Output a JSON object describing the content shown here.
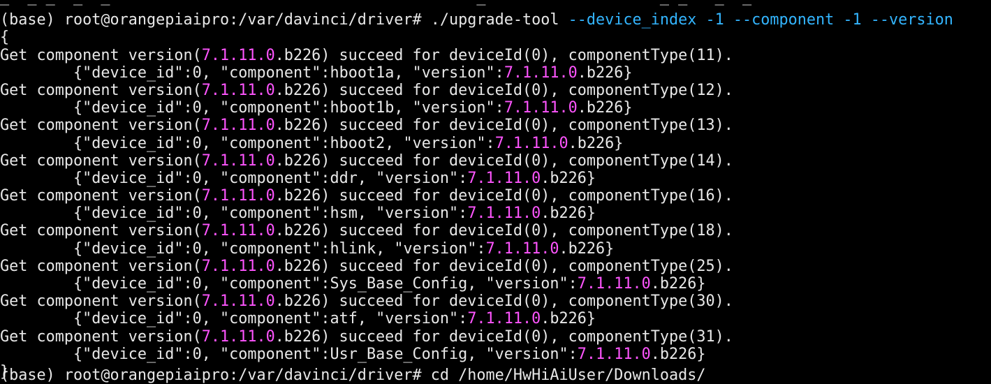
{
  "terminal": {
    "colors": {
      "background": "#000000",
      "text": "#e8e8e8",
      "number": "#ff55ff",
      "option": "#33b5ff"
    },
    "partial_top_line": "_  _ _  _  _                                        _                   _ _   _  _ ",
    "prompt": "(base) root@orangepiaipro:/var/davinci/driver# ",
    "command": "./upgrade-tool",
    "args": [
      " --device_index",
      " -1",
      " --component",
      " -1",
      " --version"
    ],
    "open_brace": "{",
    "close_brace": "}",
    "partial_bottom_line": "(base) root@orangepiaipro:/var/davinci/driver# cd /home/HwHiAiUser/Downloads/",
    "entries": [
      {
        "get_prefix": "Get component version(",
        "ver_major": "7.1.11.0",
        "ver_build": ".b226",
        "get_mid": ") succeed for deviceId(0), componentType(",
        "type": "11",
        "get_end": ").",
        "json_prefix": "{\"device_id\":0, \"component\":",
        "component": "hboot1a",
        "json_mid": ", \"version\":",
        "json_ver_major": "7.1.11.0",
        "json_ver_build": ".b226",
        "json_end": "}"
      },
      {
        "get_prefix": "Get component version(",
        "ver_major": "7.1.11.0",
        "ver_build": ".b226",
        "get_mid": ") succeed for deviceId(0), componentType(",
        "type": "12",
        "get_end": ").",
        "json_prefix": "{\"device_id\":0, \"component\":",
        "component": "hboot1b",
        "json_mid": ", \"version\":",
        "json_ver_major": "7.1.11.0",
        "json_ver_build": ".b226",
        "json_end": "}"
      },
      {
        "get_prefix": "Get component version(",
        "ver_major": "7.1.11.0",
        "ver_build": ".b226",
        "get_mid": ") succeed for deviceId(0), componentType(",
        "type": "13",
        "get_end": ").",
        "json_prefix": "{\"device_id\":0, \"component\":",
        "component": "hboot2",
        "json_mid": ", \"version\":",
        "json_ver_major": "7.1.11.0",
        "json_ver_build": ".b226",
        "json_end": "}"
      },
      {
        "get_prefix": "Get component version(",
        "ver_major": "7.1.11.0",
        "ver_build": ".b226",
        "get_mid": ") succeed for deviceId(0), componentType(",
        "type": "14",
        "get_end": ").",
        "json_prefix": "{\"device_id\":0, \"component\":",
        "component": "ddr",
        "json_mid": ", \"version\":",
        "json_ver_major": "7.1.11.0",
        "json_ver_build": ".b226",
        "json_end": "}"
      },
      {
        "get_prefix": "Get component version(",
        "ver_major": "7.1.11.0",
        "ver_build": ".b226",
        "get_mid": ") succeed for deviceId(0), componentType(",
        "type": "16",
        "get_end": ").",
        "json_prefix": "{\"device_id\":0, \"component\":",
        "component": "hsm",
        "json_mid": ", \"version\":",
        "json_ver_major": "7.1.11.0",
        "json_ver_build": ".b226",
        "json_end": "}"
      },
      {
        "get_prefix": "Get component version(",
        "ver_major": "7.1.11.0",
        "ver_build": ".b226",
        "get_mid": ") succeed for deviceId(0), componentType(",
        "type": "18",
        "get_end": ").",
        "json_prefix": "{\"device_id\":0, \"component\":",
        "component": "hlink",
        "json_mid": ", \"version\":",
        "json_ver_major": "7.1.11.0",
        "json_ver_build": ".b226",
        "json_end": "}"
      },
      {
        "get_prefix": "Get component version(",
        "ver_major": "7.1.11.0",
        "ver_build": ".b226",
        "get_mid": ") succeed for deviceId(0), componentType(",
        "type": "25",
        "get_end": ").",
        "json_prefix": "{\"device_id\":0, \"component\":",
        "component": "Sys_Base_Config",
        "json_mid": ", \"version\":",
        "json_ver_major": "7.1.11.0",
        "json_ver_build": ".b226",
        "json_end": "}"
      },
      {
        "get_prefix": "Get component version(",
        "ver_major": "7.1.11.0",
        "ver_build": ".b226",
        "get_mid": ") succeed for deviceId(0), componentType(",
        "type": "30",
        "get_end": ").",
        "json_prefix": "{\"device_id\":0, \"component\":",
        "component": "atf",
        "json_mid": ", \"version\":",
        "json_ver_major": "7.1.11.0",
        "json_ver_build": ".b226",
        "json_end": "}"
      },
      {
        "get_prefix": "Get component version(",
        "ver_major": "7.1.11.0",
        "ver_build": ".b226",
        "get_mid": ") succeed for deviceId(0), componentType(",
        "type": "31",
        "get_end": ").",
        "json_prefix": "{\"device_id\":0, \"component\":",
        "component": "Usr_Base_Config",
        "json_mid": ", \"version\":",
        "json_ver_major": "7.1.11.0",
        "json_ver_build": ".b226",
        "json_end": "}"
      }
    ]
  }
}
